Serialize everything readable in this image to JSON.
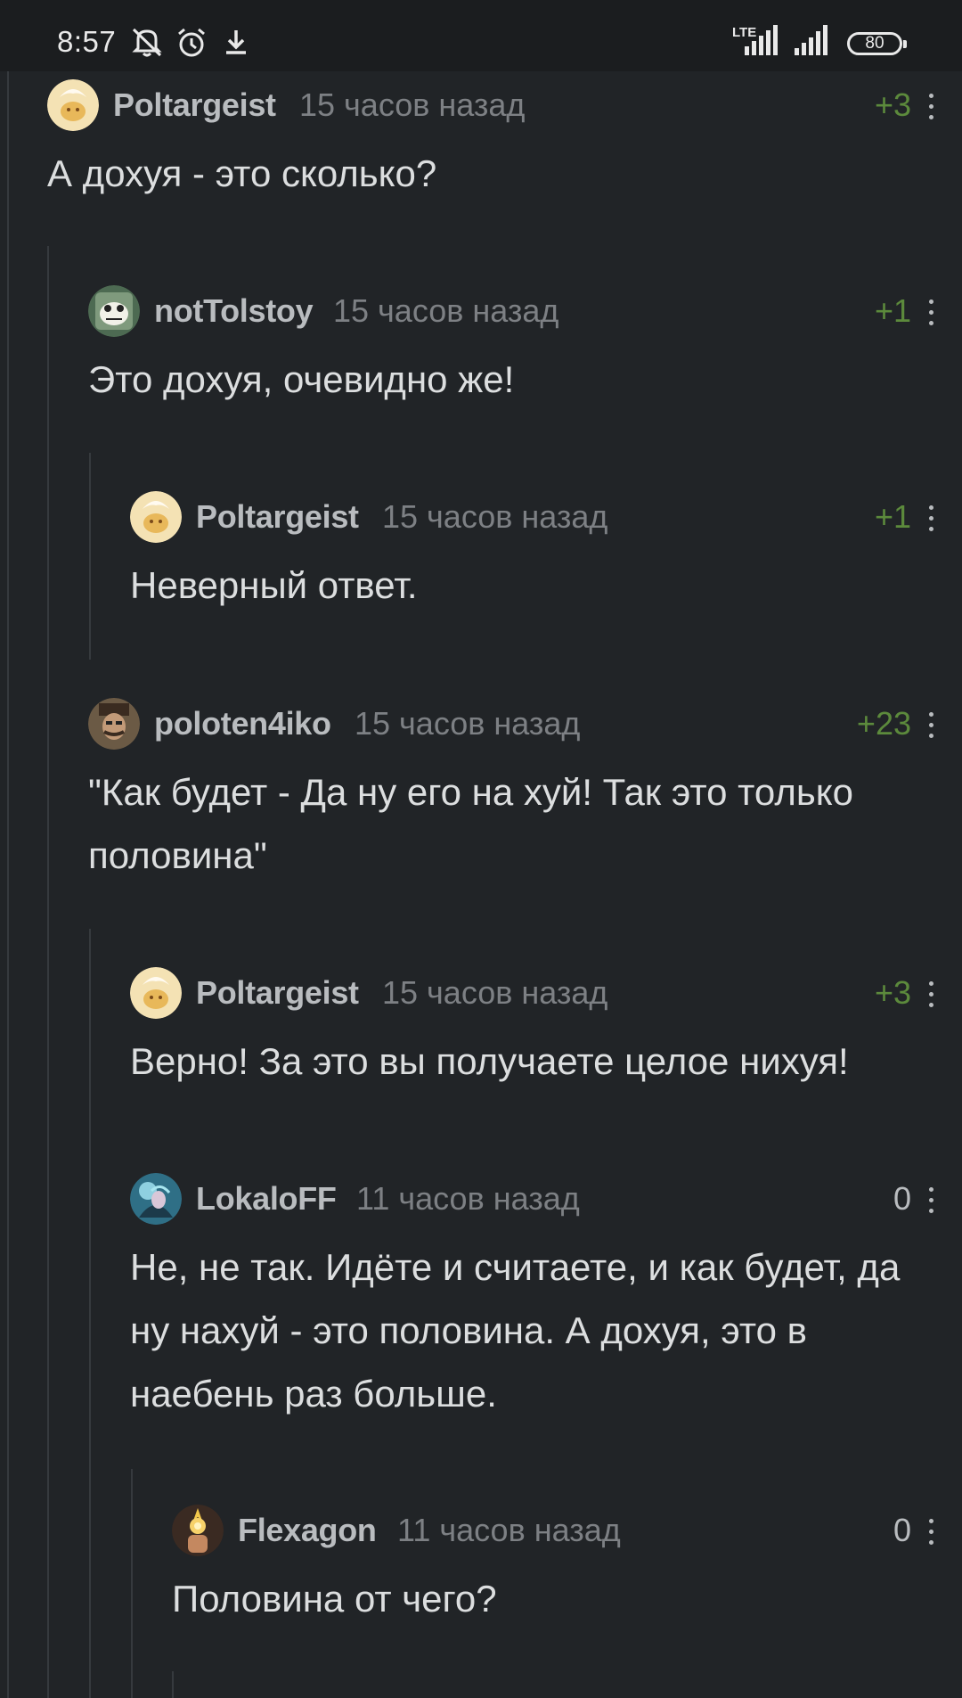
{
  "status_bar": {
    "time": "8:57",
    "network": "LTE",
    "battery": "80"
  },
  "comments": [
    {
      "author": "Poltargeist",
      "time": "15 часов назад",
      "rating": "+3",
      "text": "А дохуя - это сколько?"
    },
    {
      "author": "notTolstoy",
      "time": "15 часов назад",
      "rating": "+1",
      "text": "Это дохуя, очевидно же!"
    },
    {
      "author": "Poltargeist",
      "time": "15 часов назад",
      "rating": "+1",
      "text": "Неверный ответ."
    },
    {
      "author": "poloten4iko",
      "time": "15 часов назад",
      "rating": "+23",
      "text": "\"Как будет - Да ну его на хуй! Так это только половина\""
    },
    {
      "author": "Poltargeist",
      "time": "15 часов назад",
      "rating": "+3",
      "text": "Верно! За это вы получаете целое нихуя!"
    },
    {
      "author": "LokaloFF",
      "time": "11 часов назад",
      "rating": "0",
      "text": "Не, не так. Идёте и считаете, и как будет, да ну нахуй - это половина. А дохуя, это в наебень раз больше."
    },
    {
      "author": "Flexagon",
      "time": "11 часов назад",
      "rating": "0",
      "text": "Половина от чего?"
    }
  ],
  "colors": {
    "background": "#212427",
    "positive_rating": "#5c8a3c",
    "author": "#b9bcbf",
    "timestamp": "#7d8084",
    "body_text": "#dcdedf"
  },
  "icons": [
    "bell-off-icon",
    "alarm-icon",
    "download-icon",
    "signal-icon",
    "battery-icon",
    "more-vertical-icon",
    "avatar"
  ]
}
